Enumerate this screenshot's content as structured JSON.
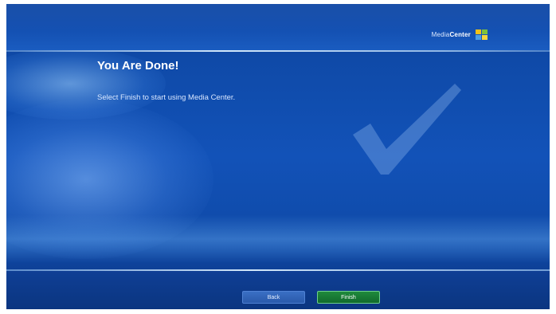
{
  "app": {
    "brand_light": "Media",
    "brand_bold": "Center",
    "logo_icon": "windows-flag-icon"
  },
  "page": {
    "title": "You Are Done!",
    "message": "Select Finish to start using Media Center.",
    "decoration_icon": "checkmark-icon"
  },
  "buttons": {
    "back_label": "Back",
    "finish_label": "Finish"
  },
  "colors": {
    "background": "#1252b8",
    "finish_button": "#1f8a3c",
    "back_button": "#3a6fc4"
  }
}
